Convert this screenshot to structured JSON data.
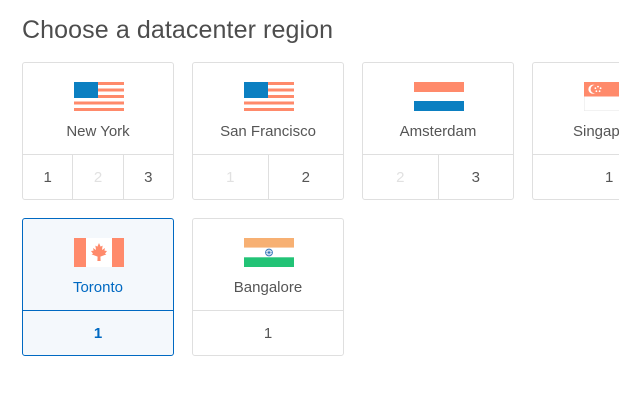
{
  "page": {
    "title": "Choose a datacenter region"
  },
  "regions": [
    {
      "name": "New York",
      "flag": "us-flag-icon",
      "options": [
        {
          "label": "1",
          "enabled": true
        },
        {
          "label": "2",
          "enabled": false
        },
        {
          "label": "3",
          "enabled": true
        }
      ]
    },
    {
      "name": "San Francisco",
      "flag": "us-flag-icon",
      "options": [
        {
          "label": "1",
          "enabled": false
        },
        {
          "label": "2",
          "enabled": true
        }
      ]
    },
    {
      "name": "Amsterdam",
      "flag": "netherlands-flag-icon",
      "options": [
        {
          "label": "2",
          "enabled": false
        },
        {
          "label": "3",
          "enabled": true
        }
      ]
    },
    {
      "name": "Singapore",
      "flag": "singapore-flag-icon",
      "options": [
        {
          "label": "1",
          "enabled": true
        }
      ]
    },
    {
      "name": "Toronto",
      "flag": "canada-flag-icon",
      "selected": true,
      "options": [
        {
          "label": "1",
          "enabled": true
        }
      ]
    },
    {
      "name": "Bangalore",
      "flag": "india-flag-icon",
      "options": [
        {
          "label": "1",
          "enabled": true
        }
      ]
    }
  ],
  "colors": {
    "accent": "#0069c2",
    "flag_red": "#ff8a6b",
    "flag_blue": "#0b7fc1",
    "india_saffron": "#f7b073",
    "india_green": "#22c376",
    "india_chakra": "#2a6fb5"
  }
}
